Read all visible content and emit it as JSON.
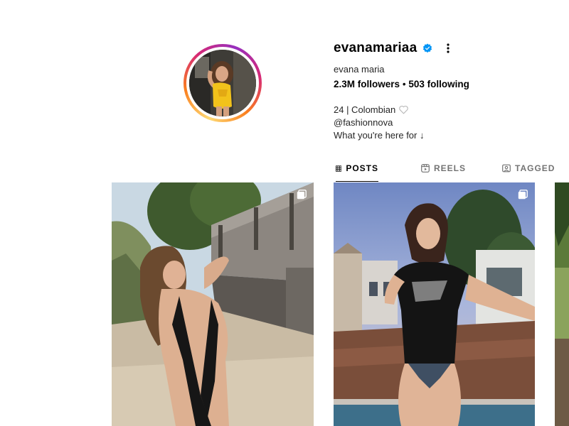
{
  "profile": {
    "username": "evanamariaa",
    "verified": true,
    "full_name": "evana maria",
    "followers_count": "2.3M",
    "followers_label": "followers",
    "separator": "•",
    "following_count": "503",
    "following_label": "following",
    "bio": {
      "line1": "24 | Colombian",
      "line2": "@fashionnova",
      "line3": "What you're here for ↓"
    }
  },
  "icons": {
    "verified": "verified-badge-icon",
    "more": "more-options-icon",
    "heart": "heart-outline-icon",
    "posts_tab": "grid-icon",
    "reels_tab": "reels-icon",
    "tagged_tab": "tagged-icon",
    "multi": "carousel-multiple-icon"
  },
  "tabs": [
    {
      "label": "POSTS",
      "active": true
    },
    {
      "label": "REELS",
      "active": false
    },
    {
      "label": "TAGGED",
      "active": false
    }
  ],
  "colors": {
    "verified_blue": "#0095f6",
    "text_primary": "#000000",
    "text_secondary": "#737373"
  }
}
